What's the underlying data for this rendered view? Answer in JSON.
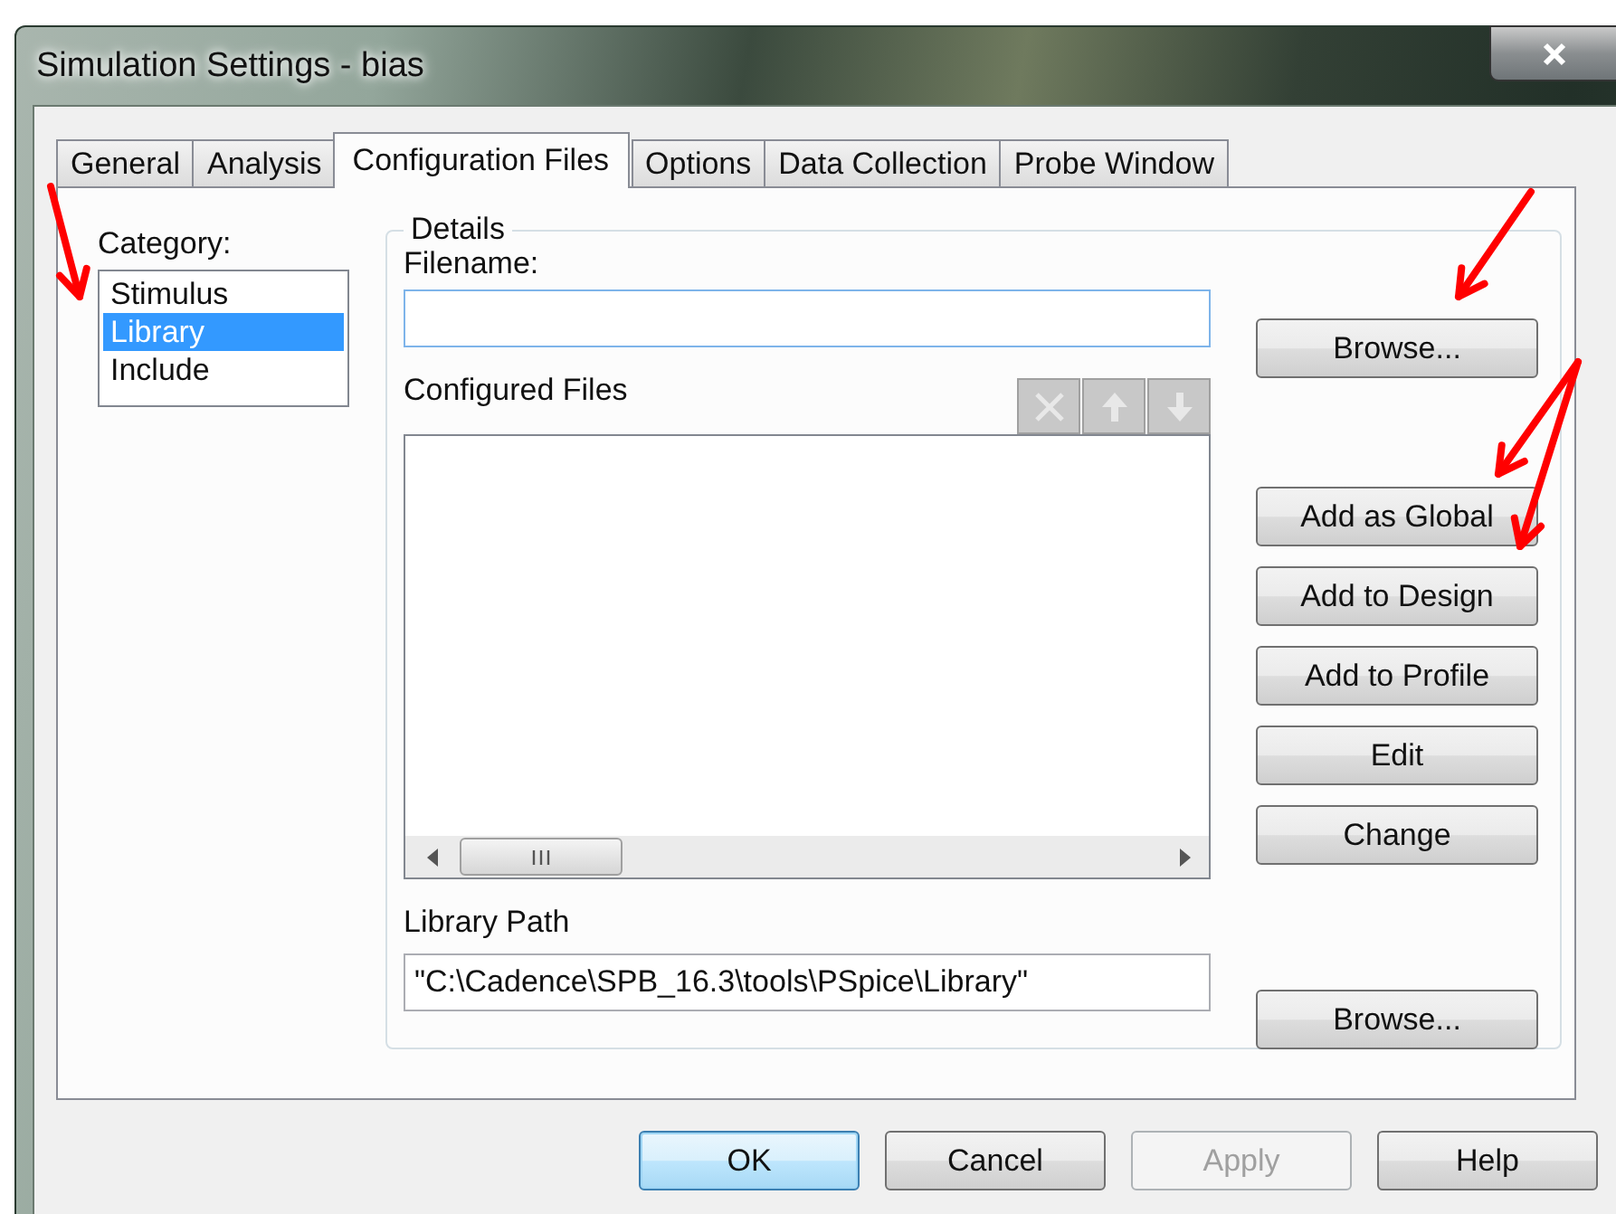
{
  "window": {
    "title": "Simulation Settings - bias"
  },
  "tabs": [
    {
      "label": "General",
      "selected": false
    },
    {
      "label": "Analysis",
      "selected": false
    },
    {
      "label": "Configuration Files",
      "selected": true
    },
    {
      "label": "Options",
      "selected": false
    },
    {
      "label": "Data Collection",
      "selected": false
    },
    {
      "label": "Probe Window",
      "selected": false
    }
  ],
  "category": {
    "label": "Category:",
    "items": [
      {
        "label": "Stimulus",
        "selected": false
      },
      {
        "label": "Library",
        "selected": true
      },
      {
        "label": "Include",
        "selected": false
      }
    ]
  },
  "details": {
    "legend": "Details",
    "filename_label": "Filename:",
    "configured_files_label": "Configured Files",
    "toolbar": [
      {
        "kind": "delete",
        "disabled": true
      },
      {
        "kind": "up",
        "disabled": true
      },
      {
        "kind": "down",
        "disabled": true
      }
    ],
    "library_path_label": "Library Path",
    "library_path": "\"C:\\Cadence\\SPB_16.3\\tools\\PSpice\\Library\"",
    "browse_filename": "Browse...",
    "actions": [
      "Add as Global",
      "Add to Design",
      "Add to Profile",
      "Edit",
      "Change"
    ],
    "browse_path": "Browse..."
  },
  "footer_buttons": [
    {
      "label": "OK",
      "default": true,
      "disabled": false
    },
    {
      "label": "Cancel",
      "default": false,
      "disabled": false
    },
    {
      "label": "Apply",
      "default": false,
      "disabled": true
    },
    {
      "label": "Help",
      "default": false,
      "disabled": false
    }
  ]
}
